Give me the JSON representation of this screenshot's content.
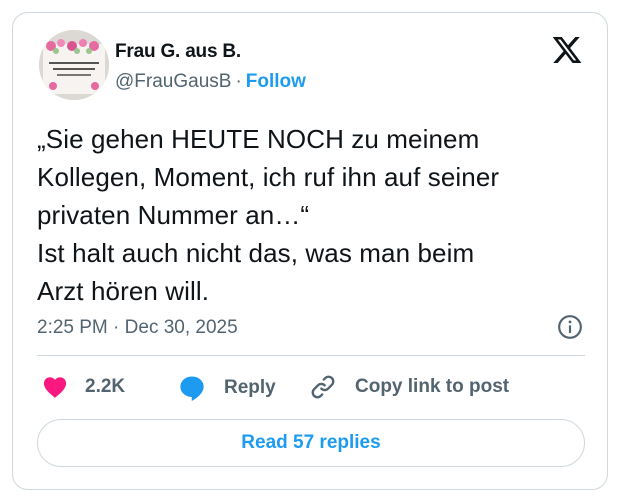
{
  "author": {
    "name": "Frau G. aus B.",
    "handle": "@FrauGausB",
    "separator": "·",
    "follow_label": "Follow",
    "avatar_icon": "mug-avatar-photo"
  },
  "tweet": {
    "lines": [
      "„Sie gehen HEUTE NOCH zu meinem",
      "Kollegen, Moment, ich ruf ihn auf seiner",
      "privaten Nummer an…“",
      "Ist halt auch nicht das, was man beim",
      "Arzt hören will."
    ],
    "time": "2:25 PM",
    "separator": "·",
    "date": "Dec 30, 2025"
  },
  "actions": {
    "likes": "2.2K",
    "reply_label": "Reply",
    "copy_label": "Copy link to post"
  },
  "footer": {
    "read_replies_label": "Read 57 replies"
  },
  "colors": {
    "accent": "#1d9bf0",
    "like": "#f91880",
    "muted": "#536471",
    "border": "#cfd9de"
  },
  "icons": [
    "x-logo-icon",
    "info-icon",
    "heart-icon",
    "reply-bubble-icon",
    "link-icon"
  ]
}
